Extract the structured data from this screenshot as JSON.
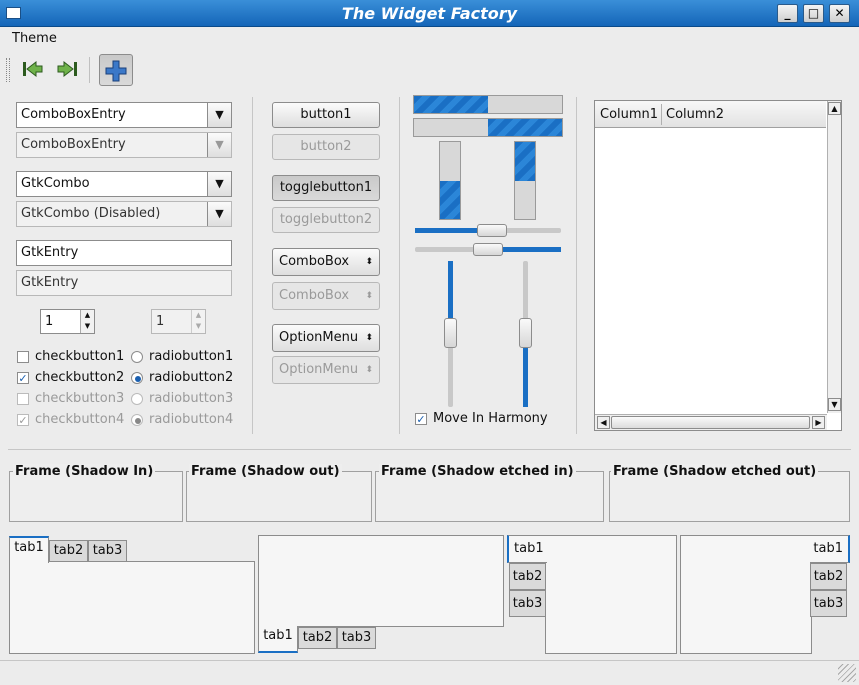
{
  "window": {
    "title": "The Widget Factory",
    "buttons": [
      "_",
      "□",
      "✕"
    ]
  },
  "menubar": {
    "items": [
      "Theme"
    ]
  },
  "toolbar": {
    "icons": [
      "go-first-icon",
      "go-last-icon",
      "add-icon"
    ]
  },
  "combos": {
    "entry1": "ComboBoxEntry",
    "entry2": "ComboBoxEntry",
    "gtk1": "GtkCombo",
    "gtk2": "GtkCombo (Disabled)"
  },
  "entries": {
    "e1": "GtkEntry",
    "e2": "GtkEntry"
  },
  "spins": {
    "s1": "1",
    "s2": "1"
  },
  "checks": [
    {
      "label": "checkbutton1",
      "checked": false,
      "disabled": false
    },
    {
      "label": "checkbutton2",
      "checked": true,
      "disabled": false
    },
    {
      "label": "checkbutton3",
      "checked": false,
      "disabled": true
    },
    {
      "label": "checkbutton4",
      "checked": true,
      "disabled": true
    }
  ],
  "radios": [
    {
      "label": "radiobutton1",
      "checked": false,
      "disabled": false
    },
    {
      "label": "radiobutton2",
      "checked": true,
      "disabled": false
    },
    {
      "label": "radiobutton3",
      "checked": false,
      "disabled": true
    },
    {
      "label": "radiobutton4",
      "checked": true,
      "disabled": true
    }
  ],
  "buttons": {
    "button1": "button1",
    "button2": "button2",
    "toggle1": "togglebutton1",
    "toggle2": "togglebutton2",
    "combobox1": "ComboBox",
    "combobox2": "ComboBox",
    "option1": "OptionMenu",
    "option2": "OptionMenu"
  },
  "progress": {
    "h1": 0.5,
    "h2": 0.5,
    "v1": 0.5,
    "v2": 0.5
  },
  "harmony": {
    "label": "Move In Harmony",
    "checked": true
  },
  "tree": {
    "columns": [
      "Column1",
      "Column2"
    ]
  },
  "frames": [
    "Frame (Shadow In)",
    "Frame (Shadow out)",
    "Frame (Shadow etched in)",
    "Frame (Shadow etched out)"
  ],
  "tabs": [
    "tab1",
    "tab2",
    "tab3"
  ]
}
